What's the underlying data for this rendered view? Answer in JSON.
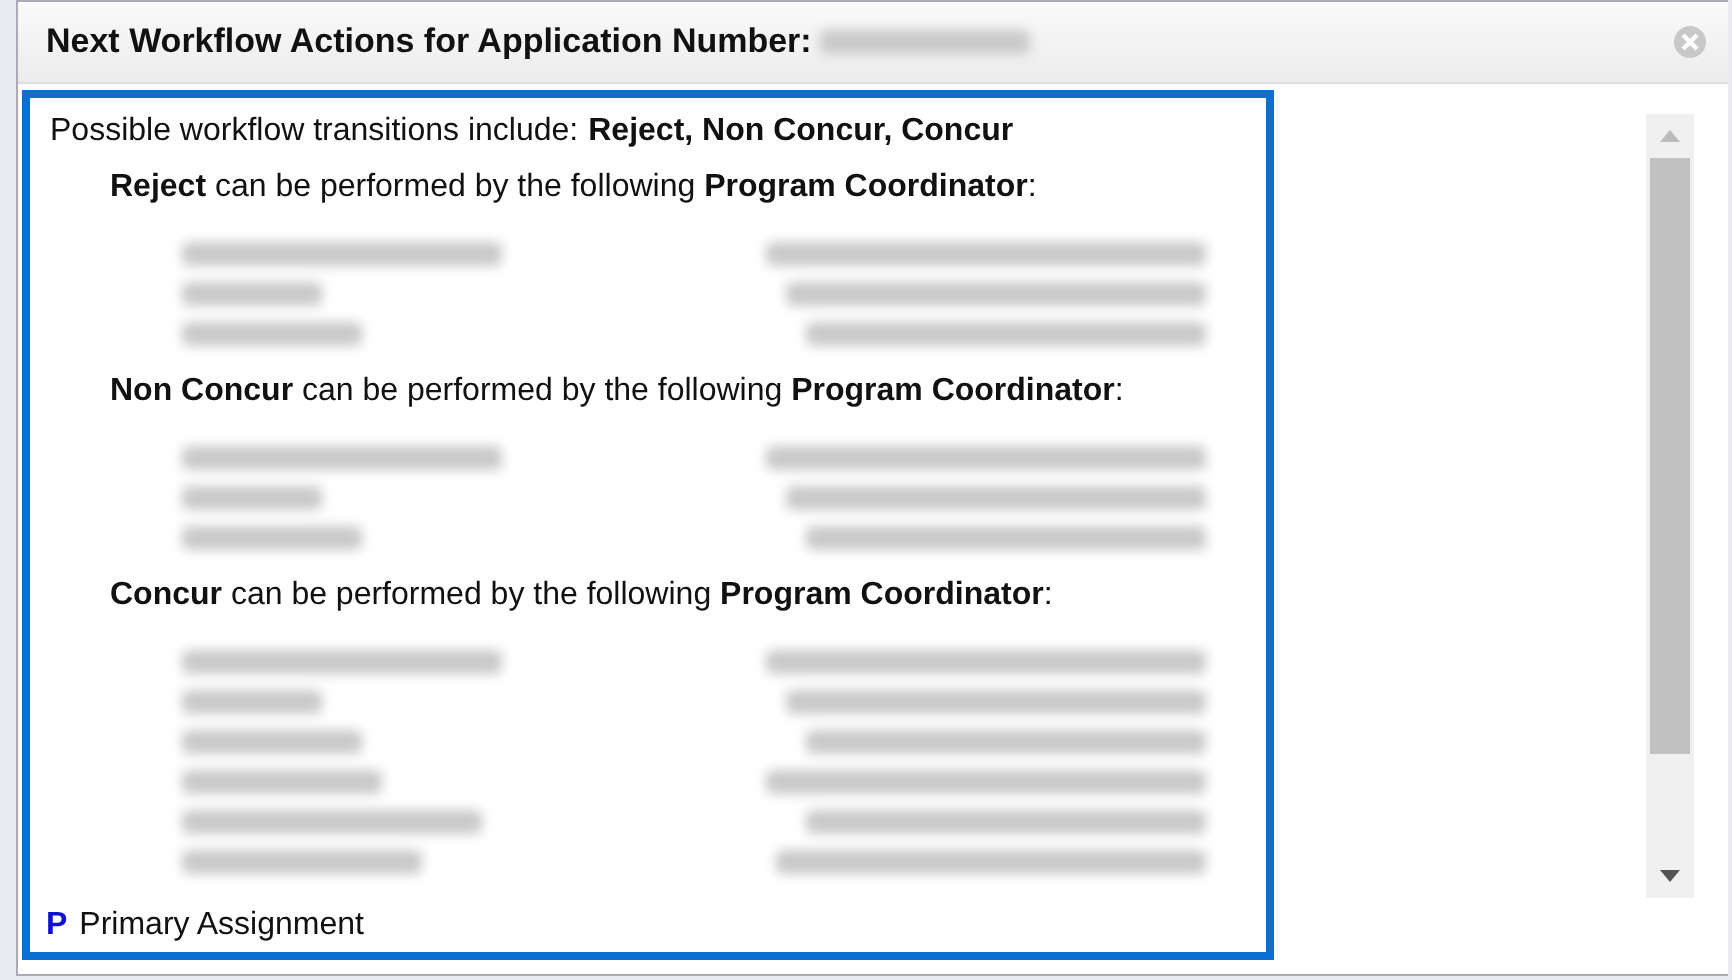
{
  "dialog": {
    "title": "Next Workflow Actions for Application Number:",
    "number_redacted": true
  },
  "intro": {
    "label": "Possible workflow transitions include:",
    "transitions": "Reject, Non Concur, Concur"
  },
  "sections": [
    {
      "heading": "**Reject** can be performed by the following **Program Coordinator**:",
      "assignees": [
        {
          "kind": "redacted"
        },
        {
          "kind": "redacted"
        },
        {
          "kind": "redacted"
        }
      ]
    },
    {
      "heading": "**Non Concur** can be performed by the following **Program Coordinator**:",
      "assignees": [
        {
          "kind": "redacted"
        },
        {
          "kind": "redacted"
        },
        {
          "kind": "redacted"
        }
      ]
    },
    {
      "heading": "**Concur** can be performed by the following **Program Coordinator**:",
      "assignees": [
        {
          "kind": "redacted"
        },
        {
          "kind": "redacted"
        },
        {
          "kind": "redacted"
        },
        {
          "kind": "redacted"
        },
        {
          "kind": "redacted"
        },
        {
          "kind": "redacted"
        }
      ]
    }
  ],
  "legend": {
    "mark": "P",
    "label": "Primary Assignment"
  }
}
